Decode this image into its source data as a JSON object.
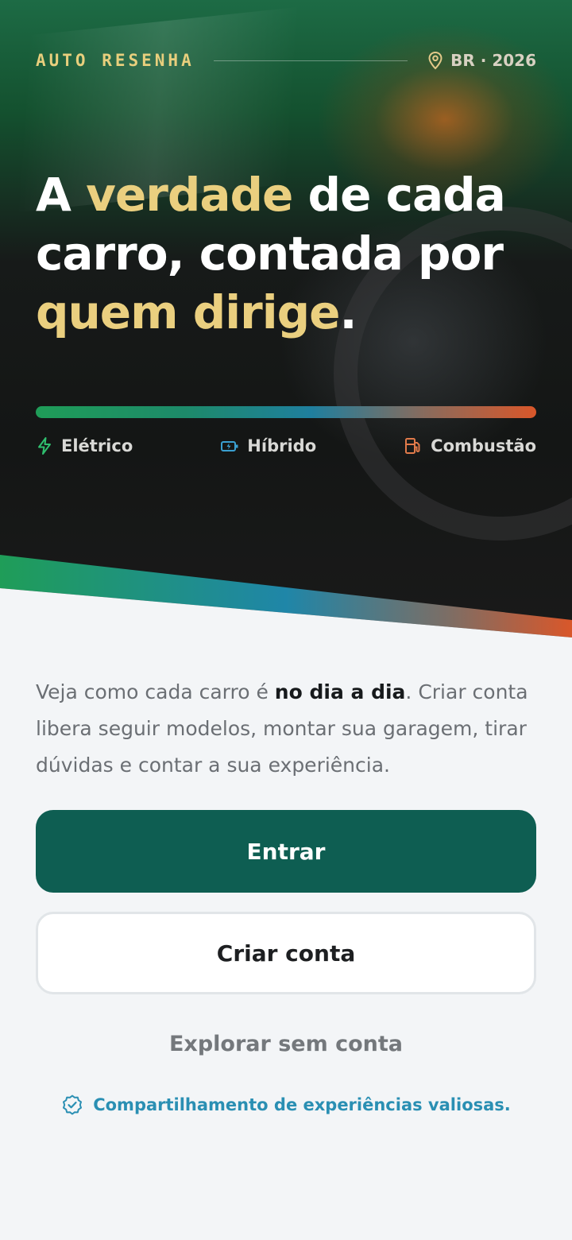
{
  "header": {
    "brand": "AUTO RESENHA",
    "location": "BR · 2026",
    "location_icon": "map-pin-icon"
  },
  "hero": {
    "headline_parts": [
      "A ",
      "verdade",
      " de cada carro, contada por ",
      "quem dirige",
      "."
    ],
    "highlight_color": "#eacf7f",
    "powertrains": [
      {
        "label": "Elétrico",
        "icon": "lightning-icon",
        "color": "#2fbf6e"
      },
      {
        "label": "Híbrido",
        "icon": "battery-charging-icon",
        "color": "#3a9fd0"
      },
      {
        "label": "Combustão",
        "icon": "fuel-pump-icon",
        "color": "#e07a4a"
      }
    ]
  },
  "body": {
    "desc_before": "Veja como cada carro é ",
    "desc_bold": "no dia a dia",
    "desc_after": ". Criar conta libera seguir modelos, montar sua garagem, tirar dúvidas e contar a sua experiência."
  },
  "actions": {
    "login_label": "Entrar",
    "signup_label": "Criar conta",
    "explore_label": "Explorar sem conta"
  },
  "footer": {
    "note": "Compartilhamento de experiências valiosas.",
    "note_icon": "verified-badge-icon"
  },
  "colors": {
    "primary": "#0e5e52",
    "accent_gold": "#e8cf7d",
    "link_blue": "#2a8fb3"
  }
}
